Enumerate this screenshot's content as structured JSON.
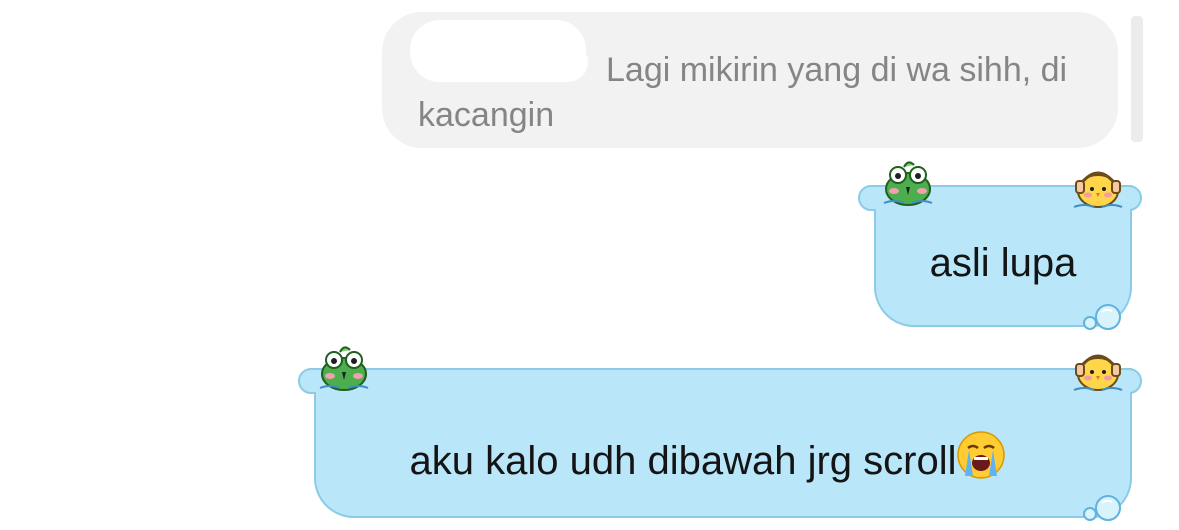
{
  "quoted_message": {
    "text": "Lagi mikirin yang di wa sihh, di kacangin"
  },
  "messages": [
    {
      "text": "asli lupa"
    },
    {
      "text": "aku kalo udh dibawah jrg scroll",
      "emoji": "loudly-crying-face-emoji"
    }
  ],
  "colors": {
    "bubble_fill": "#b9e6f8",
    "bubble_border": "#8ccbe8",
    "quote_bg": "#f2f2f2",
    "quote_text": "#858585",
    "message_text": "#141414"
  },
  "decorations": [
    "frog-mascot-icon",
    "chick-with-headphones-icon",
    "water-bubbles-icon"
  ]
}
